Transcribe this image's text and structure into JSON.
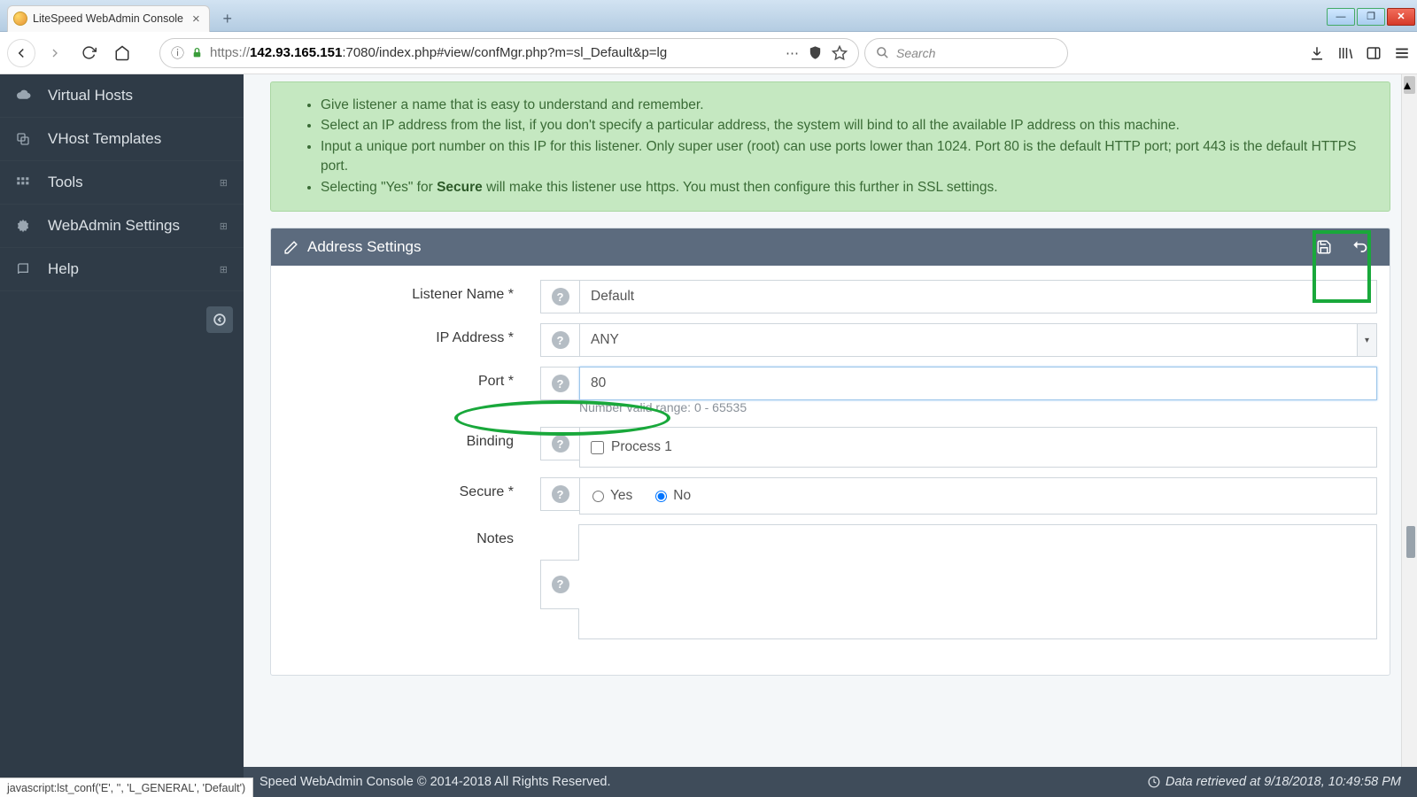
{
  "browser": {
    "tab_title": "LiteSpeed WebAdmin Console",
    "url_host": "142.93.165.151",
    "url_rest": ":7080/index.php#view/confMgr.php?m=sl_Default&p=lg",
    "search_placeholder": "Search",
    "status_link": "javascript:lst_conf('E', '', 'L_GENERAL', 'Default')"
  },
  "sidebar": {
    "items": [
      {
        "label": "Virtual Hosts",
        "icon": "cloud"
      },
      {
        "label": "VHost Templates",
        "icon": "copy"
      },
      {
        "label": "Tools",
        "icon": "grid",
        "expand": true
      },
      {
        "label": "WebAdmin Settings",
        "icon": "gear",
        "expand": true
      },
      {
        "label": "Help",
        "icon": "book",
        "expand": true
      }
    ]
  },
  "tips": [
    "Give listener a name that is easy to understand and remember.",
    "Select an IP address from the list, if you don't specify a particular address, the system will bind to all the available IP address on this machine.",
    "Input a unique port number on this IP for this listener. Only super user (root) can use ports lower than 1024. Port 80 is the default HTTP port; port 443 is the default HTTPS port.",
    "Selecting \"Yes\" for Secure will make this listener use https. You must then configure this further in SSL settings."
  ],
  "panel": {
    "title": "Address Settings"
  },
  "form": {
    "listener_name": {
      "label": "Listener Name *",
      "value": "Default"
    },
    "ip_address": {
      "label": "IP Address *",
      "value": "ANY"
    },
    "port": {
      "label": "Port *",
      "value": "80",
      "hint": "Number valid range: 0 - 65535"
    },
    "binding": {
      "label": "Binding",
      "option": "Process 1",
      "checked": false
    },
    "secure": {
      "label": "Secure *",
      "yes": "Yes",
      "no": "No",
      "value": "No"
    },
    "notes": {
      "label": "Notes",
      "value": ""
    }
  },
  "footer": {
    "left": "Speed WebAdmin Console © 2014-2018 All Rights Reserved.",
    "right": "Data retrieved at 9/18/2018, 10:49:58 PM"
  }
}
